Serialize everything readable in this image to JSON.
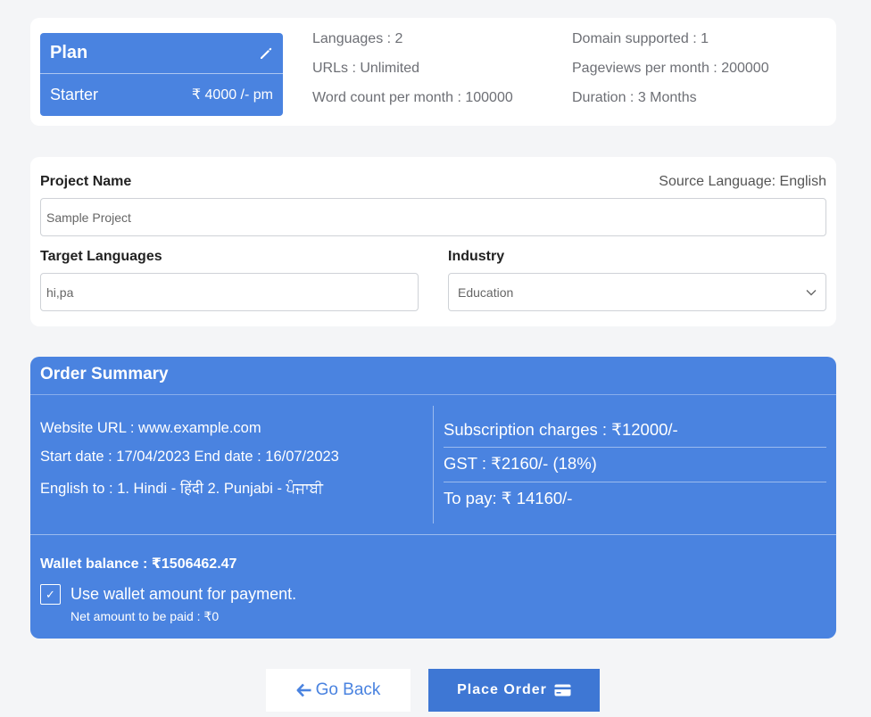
{
  "plan": {
    "title": "Plan",
    "name": "Starter",
    "price": "₹ 4000 /- pm",
    "specs": {
      "languages": "Languages : 2",
      "urls": "URLs : Unlimited",
      "word_count": "Word count per month : 100000",
      "domains": "Domain supported : 1",
      "pageviews": "Pageviews per month : 200000",
      "duration": "Duration : 3 Months"
    }
  },
  "project": {
    "name_label": "Project Name",
    "source_language": "Source Language: English",
    "name_placeholder": "Sample Project",
    "target_label": "Target Languages",
    "target_value": "hi,pa",
    "industry_label": "Industry",
    "industry_value": "Education"
  },
  "order": {
    "title": "Order Summary",
    "website": "Website URL : www.example.com",
    "dates": "Start date : 17/04/2023 End date : 16/07/2023",
    "languages": "English to : 1. Hindi - हिंदी   2. Punjabi - ਪੰਜਾਬੀ",
    "subscription": "Subscription charges : ₹12000/-",
    "gst": "GST : ₹2160/- (18%)",
    "to_pay": "To pay: ₹ 14160/-",
    "wallet_balance": "Wallet balance : ₹1506462.47",
    "use_wallet": "Use wallet amount for payment.",
    "use_wallet_checked": true,
    "net_amount": "Net amount to be paid : ₹0"
  },
  "actions": {
    "go_back": "Go Back",
    "place_order": "Place Order"
  },
  "colors": {
    "accent": "#4a83e0",
    "button_primary": "#3e77d4"
  },
  "icons": {
    "edit": "pencil-icon",
    "back": "arrow-left-icon",
    "payment": "credit-card-icon",
    "select": "chevron-down-icon",
    "check": "check-icon"
  }
}
